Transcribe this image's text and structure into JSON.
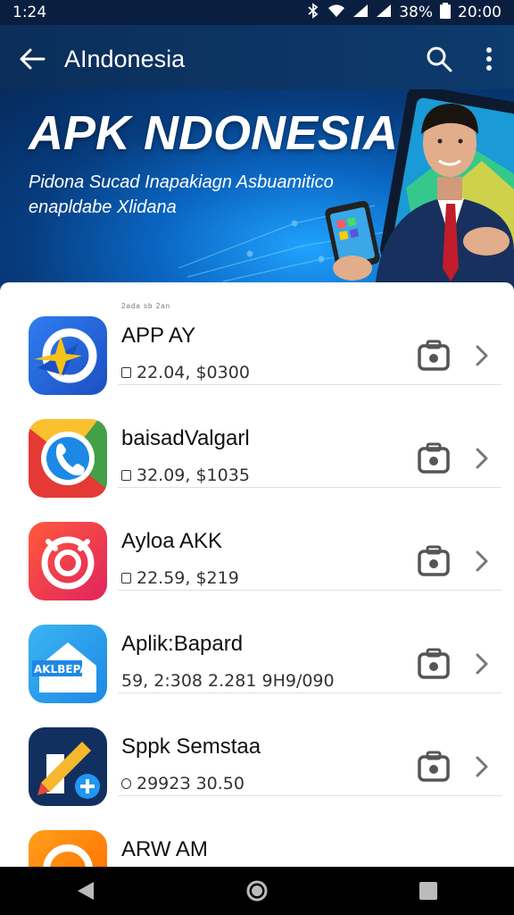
{
  "status": {
    "time": "1:24",
    "battery": "38%",
    "clock": "20:00"
  },
  "appbar": {
    "title": "AIndonesia"
  },
  "banner": {
    "title": "APK NDONESIA",
    "subtitle": "Pidona Suсad Inapakiagn Asbuamitico enapldabe Xlidana"
  },
  "list": {
    "tiny_label": "2ada sb 2an",
    "items": [
      {
        "name": "APP AY",
        "meta": "22.04, $0300"
      },
      {
        "name": "baisadValgarl",
        "meta": "32.09, $1035"
      },
      {
        "name": "Ayloa AKK",
        "meta": "22.59, $219"
      },
      {
        "name": "Aplik:Bapard",
        "meta": "59, 2:308 2.281 9H9/090"
      },
      {
        "name": "Sppk Semstaa",
        "meta": "2992З 30.50"
      },
      {
        "name": "ARW AM",
        "meta": ""
      }
    ],
    "icon_label_4": "AKLBEPA"
  }
}
